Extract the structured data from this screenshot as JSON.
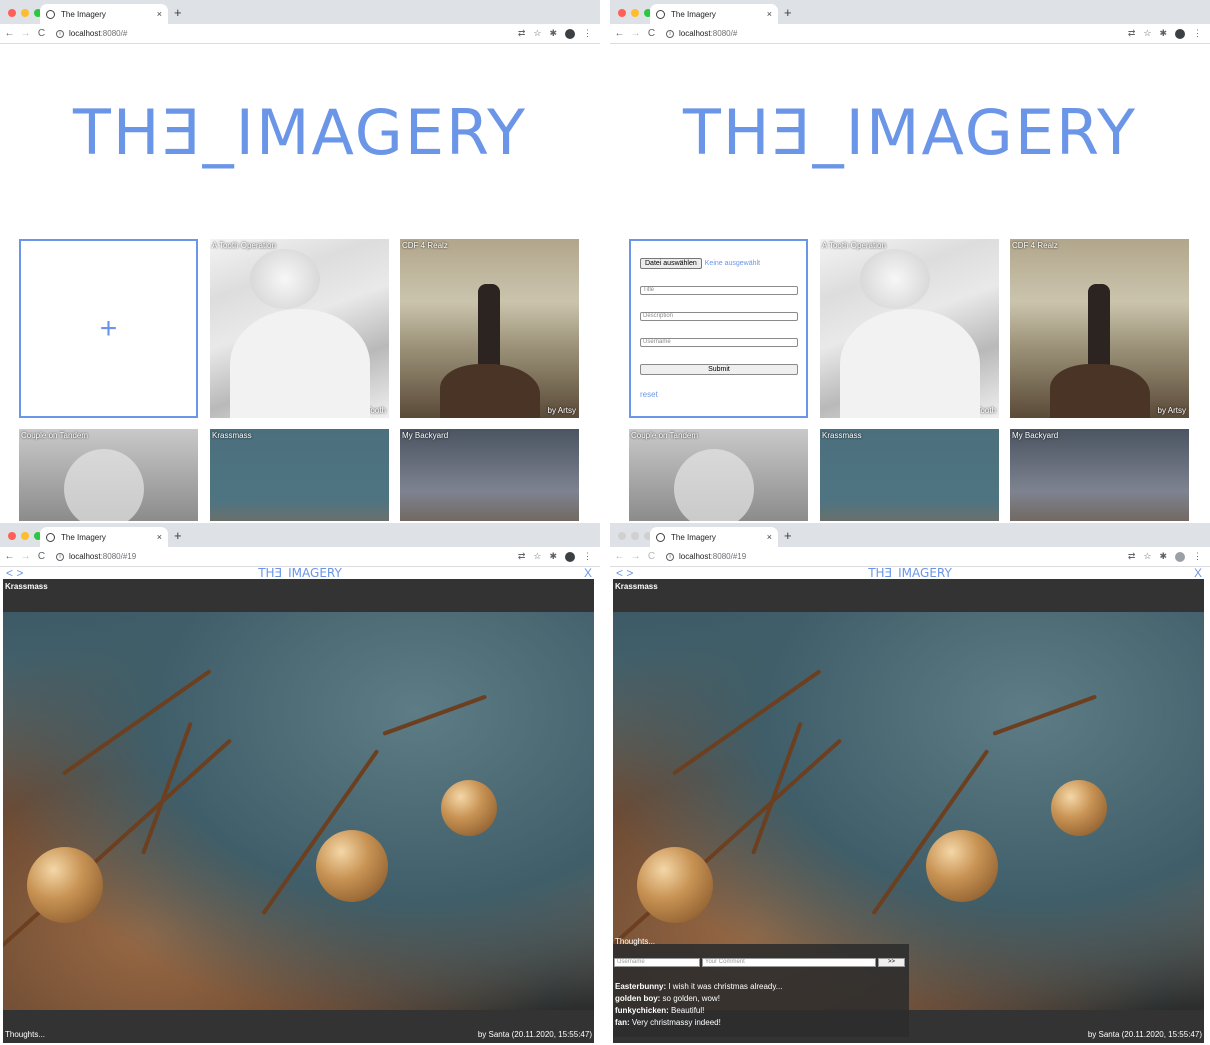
{
  "browser": {
    "tab_title": "The Imagery",
    "tab_close": "×",
    "new_tab": "+",
    "url_host": "localhost",
    "url_rest_home": ":8080/#",
    "url_rest_detail": ":8080/#19"
  },
  "site": {
    "logo": "THƎ_IMAGERY",
    "add_symbol": "+"
  },
  "gallery": [
    {
      "title": "A Tooth Operation",
      "author": "by Dr. Tooth"
    },
    {
      "title": "CDF 4 Realz",
      "author": "by Artsy"
    },
    {
      "title": "Couple on Tandem",
      "author": ""
    },
    {
      "title": "Krassmass",
      "author": ""
    },
    {
      "title": "My Backyard",
      "author": ""
    }
  ],
  "upload_form": {
    "file_button": "Datei auswählen",
    "file_none": "Keine ausgewählt",
    "title_placeholder": "Title",
    "description_placeholder": "Description",
    "username_placeholder": "Username",
    "submit_label": "Submit",
    "reset_label": "reset"
  },
  "detail": {
    "prev_next": "< >",
    "close": "X",
    "title": "Krassmass",
    "thoughts": "Thoughts...",
    "byline": "by Santa (20.11.2020, 15:55:47)"
  },
  "comments": {
    "username_placeholder": "Username",
    "comment_placeholder": "Your Comment",
    "send_label": ">>",
    "items": [
      {
        "user": "Easterbunny:",
        "text": " I wish it was christmas already..."
      },
      {
        "user": "golden boy:",
        "text": " so golden, wow!"
      },
      {
        "user": "funkychicken:",
        "text": " Beautiful!"
      },
      {
        "user": "fan:",
        "text": " Very christmassy indeed!"
      }
    ]
  },
  "colors": {
    "accent": "#6b96e8",
    "viewer_bg": "#333333"
  }
}
